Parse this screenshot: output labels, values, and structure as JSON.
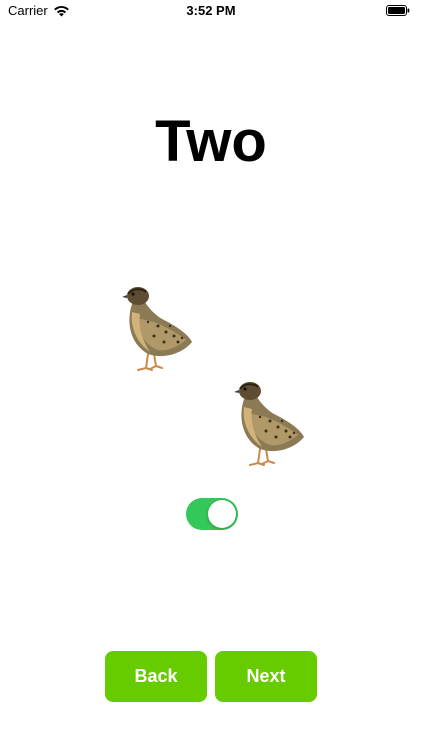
{
  "status_bar": {
    "carrier": "Carrier",
    "time": "3:52 PM",
    "wifi_icon": "wifi-icon",
    "battery_icon": "battery-icon"
  },
  "title": "Two",
  "birds": [
    "quail-icon",
    "quail-icon"
  ],
  "toggle": {
    "state": "on",
    "color": "#34c759"
  },
  "buttons": {
    "back_label": "Back",
    "next_label": "Next",
    "color": "#66cc00"
  }
}
